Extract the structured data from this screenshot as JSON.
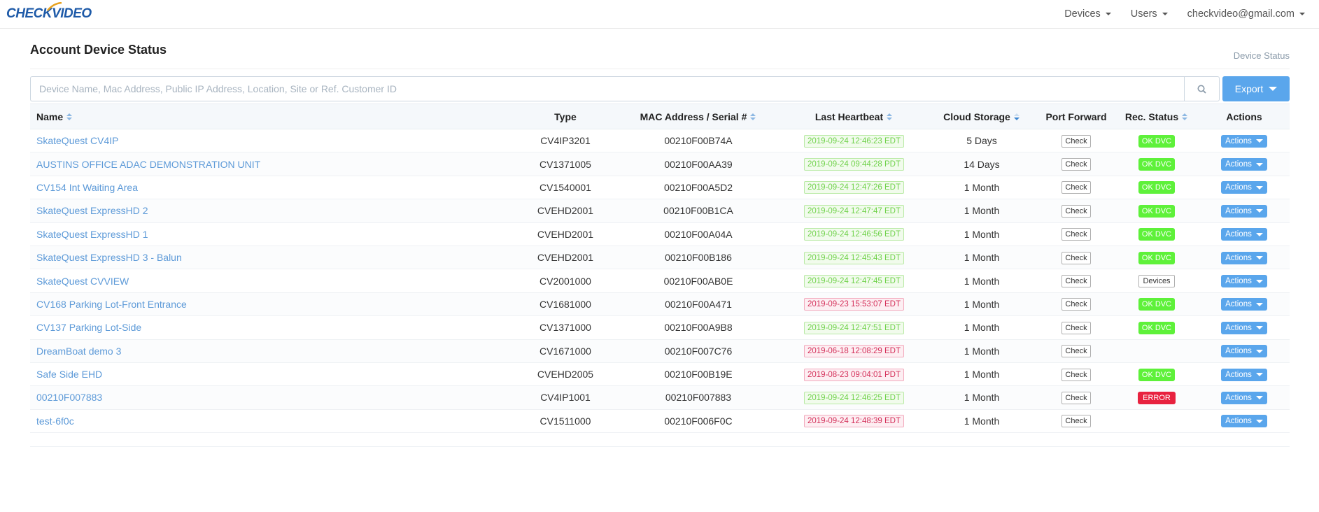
{
  "nav": {
    "logo_part1": "CHECK",
    "logo_part2": "VIDEO",
    "items": [
      {
        "label": "Devices"
      },
      {
        "label": "Users"
      },
      {
        "label": "checkvideo@gmail.com"
      }
    ]
  },
  "page": {
    "title": "Account Device Status",
    "breadcrumb": "Device Status"
  },
  "search": {
    "placeholder": "Device Name, Mac Address, Public IP Address, Location, Site or Ref. Customer ID",
    "value": ""
  },
  "export_label": "Export",
  "table": {
    "columns": [
      {
        "label": "Name",
        "sortable": true
      },
      {
        "label": "Type",
        "sortable": false
      },
      {
        "label": "MAC Address / Serial #",
        "sortable": true
      },
      {
        "label": "Last Heartbeat",
        "sortable": true
      },
      {
        "label": "Cloud Storage",
        "sortable": true,
        "sorted": "desc"
      },
      {
        "label": "Port Forward",
        "sortable": false
      },
      {
        "label": "Rec. Status",
        "sortable": true
      },
      {
        "label": "Actions",
        "sortable": false
      }
    ],
    "check_label": "Check",
    "actions_label": "Actions",
    "rows": [
      {
        "name": "SkateQuest CV4IP",
        "type": "CV4IP3201",
        "mac": "00210F00B74A",
        "heartbeat": "2019-09-24 12:46:23 EDT",
        "hb_status": "ok",
        "storage": "5 Days",
        "rec": "OK DVC",
        "rec_status": "okdvc"
      },
      {
        "name": "AUSTINS OFFICE ADAC DEMONSTRATION UNIT",
        "type": "CV1371005",
        "mac": "00210F00AA39",
        "heartbeat": "2019-09-24 09:44:28 PDT",
        "hb_status": "ok",
        "storage": "14 Days",
        "rec": "OK DVC",
        "rec_status": "okdvc"
      },
      {
        "name": "CV154 Int Waiting Area",
        "type": "CV1540001",
        "mac": "00210F00A5D2",
        "heartbeat": "2019-09-24 12:47:26 EDT",
        "hb_status": "ok",
        "storage": "1 Month",
        "rec": "OK DVC",
        "rec_status": "okdvc"
      },
      {
        "name": "SkateQuest ExpressHD 2",
        "type": "CVEHD2001",
        "mac": "00210F00B1CA",
        "heartbeat": "2019-09-24 12:47:47 EDT",
        "hb_status": "ok",
        "storage": "1 Month",
        "rec": "OK DVC",
        "rec_status": "okdvc"
      },
      {
        "name": "SkateQuest ExpressHD 1",
        "type": "CVEHD2001",
        "mac": "00210F00A04A",
        "heartbeat": "2019-09-24 12:46:56 EDT",
        "hb_status": "ok",
        "storage": "1 Month",
        "rec": "OK DVC",
        "rec_status": "okdvc"
      },
      {
        "name": "SkateQuest ExpressHD 3 - Balun",
        "type": "CVEHD2001",
        "mac": "00210F00B186",
        "heartbeat": "2019-09-24 12:45:43 EDT",
        "hb_status": "ok",
        "storage": "1 Month",
        "rec": "OK DVC",
        "rec_status": "okdvc"
      },
      {
        "name": "SkateQuest CVVIEW",
        "type": "CV2001000",
        "mac": "00210F00AB0E",
        "heartbeat": "2019-09-24 12:47:45 EDT",
        "hb_status": "ok",
        "storage": "1 Month",
        "rec": "Devices",
        "rec_status": "devices"
      },
      {
        "name": "CV168 Parking Lot-Front Entrance",
        "type": "CV1681000",
        "mac": "00210F00A471",
        "heartbeat": "2019-09-23 15:53:07 EDT",
        "hb_status": "bad",
        "storage": "1 Month",
        "rec": "OK DVC",
        "rec_status": "okdvc"
      },
      {
        "name": "CV137 Parking Lot-Side",
        "type": "CV1371000",
        "mac": "00210F00A9B8",
        "heartbeat": "2019-09-24 12:47:51 EDT",
        "hb_status": "ok",
        "storage": "1 Month",
        "rec": "OK DVC",
        "rec_status": "okdvc"
      },
      {
        "name": "DreamBoat demo 3",
        "type": "CV1671000",
        "mac": "00210F007C76",
        "heartbeat": "2019-06-18 12:08:29 EDT",
        "hb_status": "bad",
        "storage": "1 Month",
        "rec": "",
        "rec_status": "none"
      },
      {
        "name": "Safe Side EHD",
        "type": "CVEHD2005",
        "mac": "00210F00B19E",
        "heartbeat": "2019-08-23 09:04:01 PDT",
        "hb_status": "bad",
        "storage": "1 Month",
        "rec": "OK DVC",
        "rec_status": "okdvc"
      },
      {
        "name": "00210F007883",
        "type": "CV4IP1001",
        "mac": "00210F007883",
        "heartbeat": "2019-09-24 12:46:25 EDT",
        "hb_status": "ok",
        "storage": "1 Month",
        "rec": "ERROR",
        "rec_status": "error"
      },
      {
        "name": "test-6f0c",
        "type": "CV1511000",
        "mac": "00210F006F0C",
        "heartbeat": "2019-09-24 12:48:39 EDT",
        "hb_status": "bad",
        "storage": "1 Month",
        "rec": "",
        "rec_status": "none"
      }
    ]
  }
}
